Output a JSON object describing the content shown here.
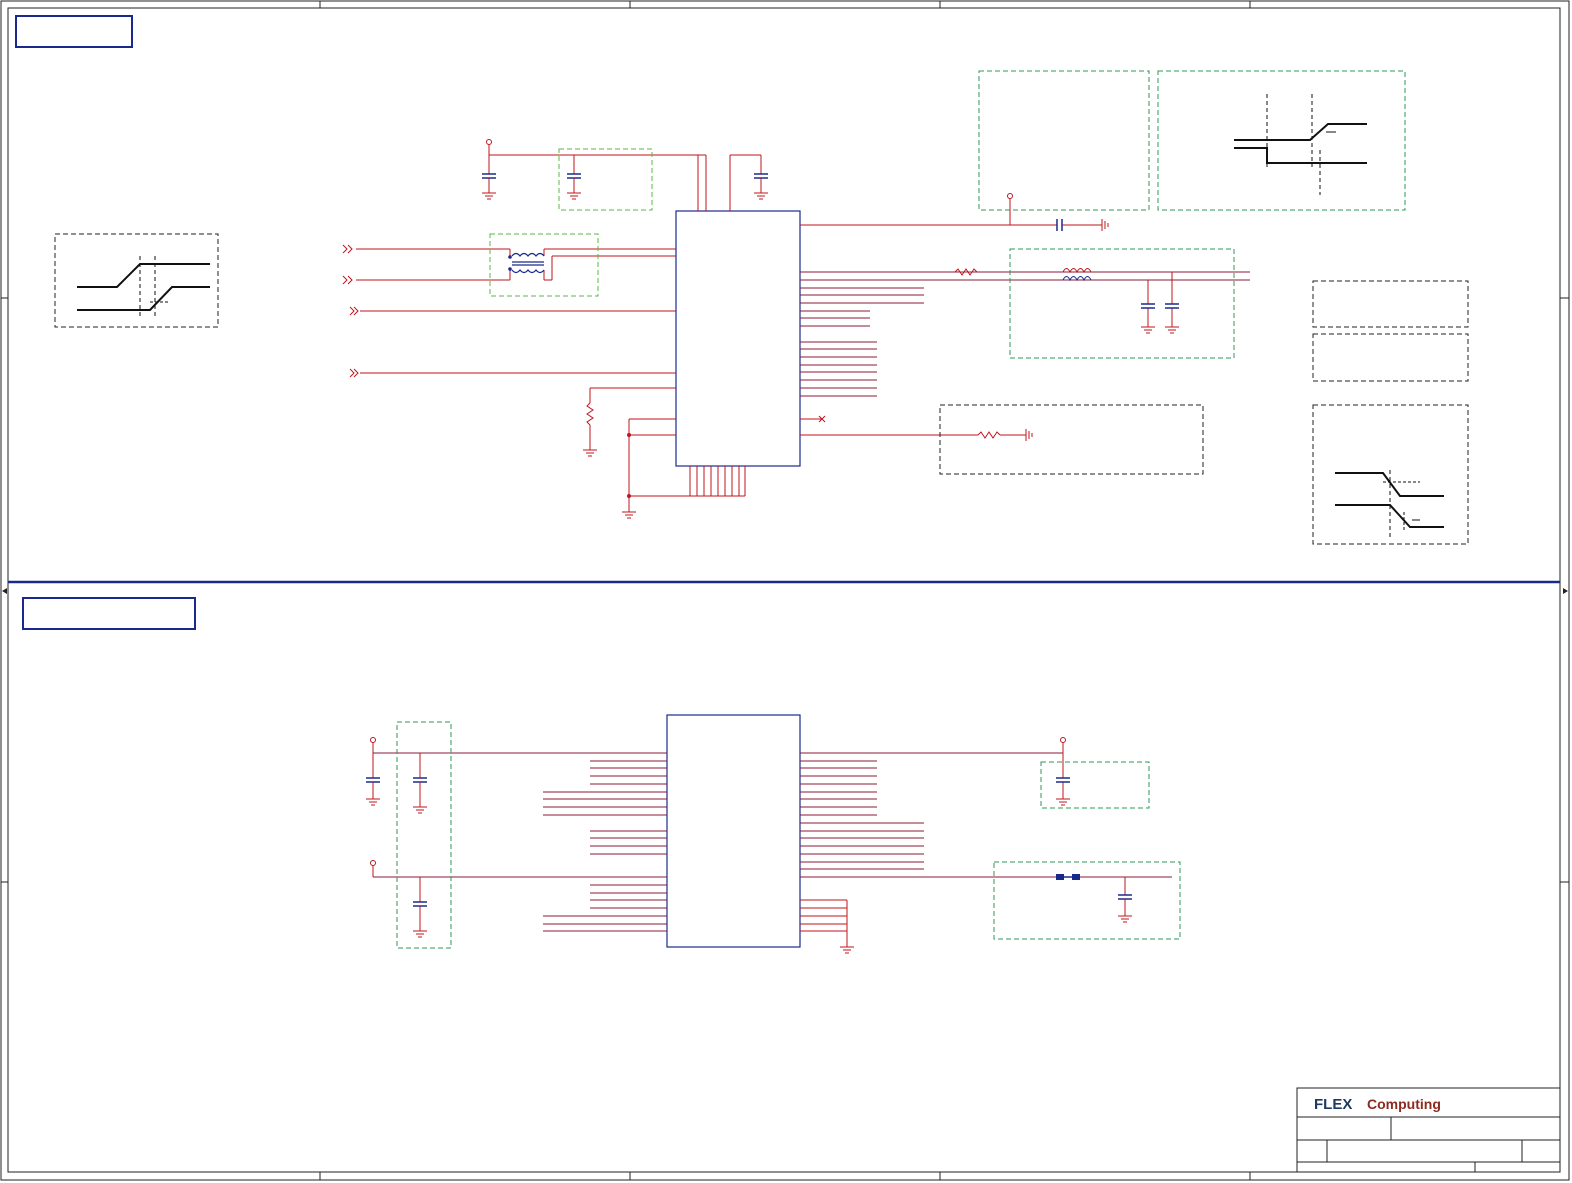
{
  "title_block": {
    "logo_brand": "FLEX",
    "logo_suffix": "Computing",
    "brand_color": "#1f3a5f",
    "suffix_color": "#8b2a1f"
  },
  "colors": {
    "frame": "#222222",
    "section_divider": "#1a2a8c",
    "wire": "#c0141e",
    "component_body": "#1a2a8c",
    "bus_wire": "#8b1a3a",
    "dashed_box_black": "#222222",
    "dashed_box_green": "#2e9a5a",
    "dashed_box_lightgreen": "#5ab84a",
    "waveform": "#111111"
  },
  "sections": [
    {
      "id": "top",
      "title": ""
    },
    {
      "id": "bottom",
      "title": ""
    }
  ]
}
